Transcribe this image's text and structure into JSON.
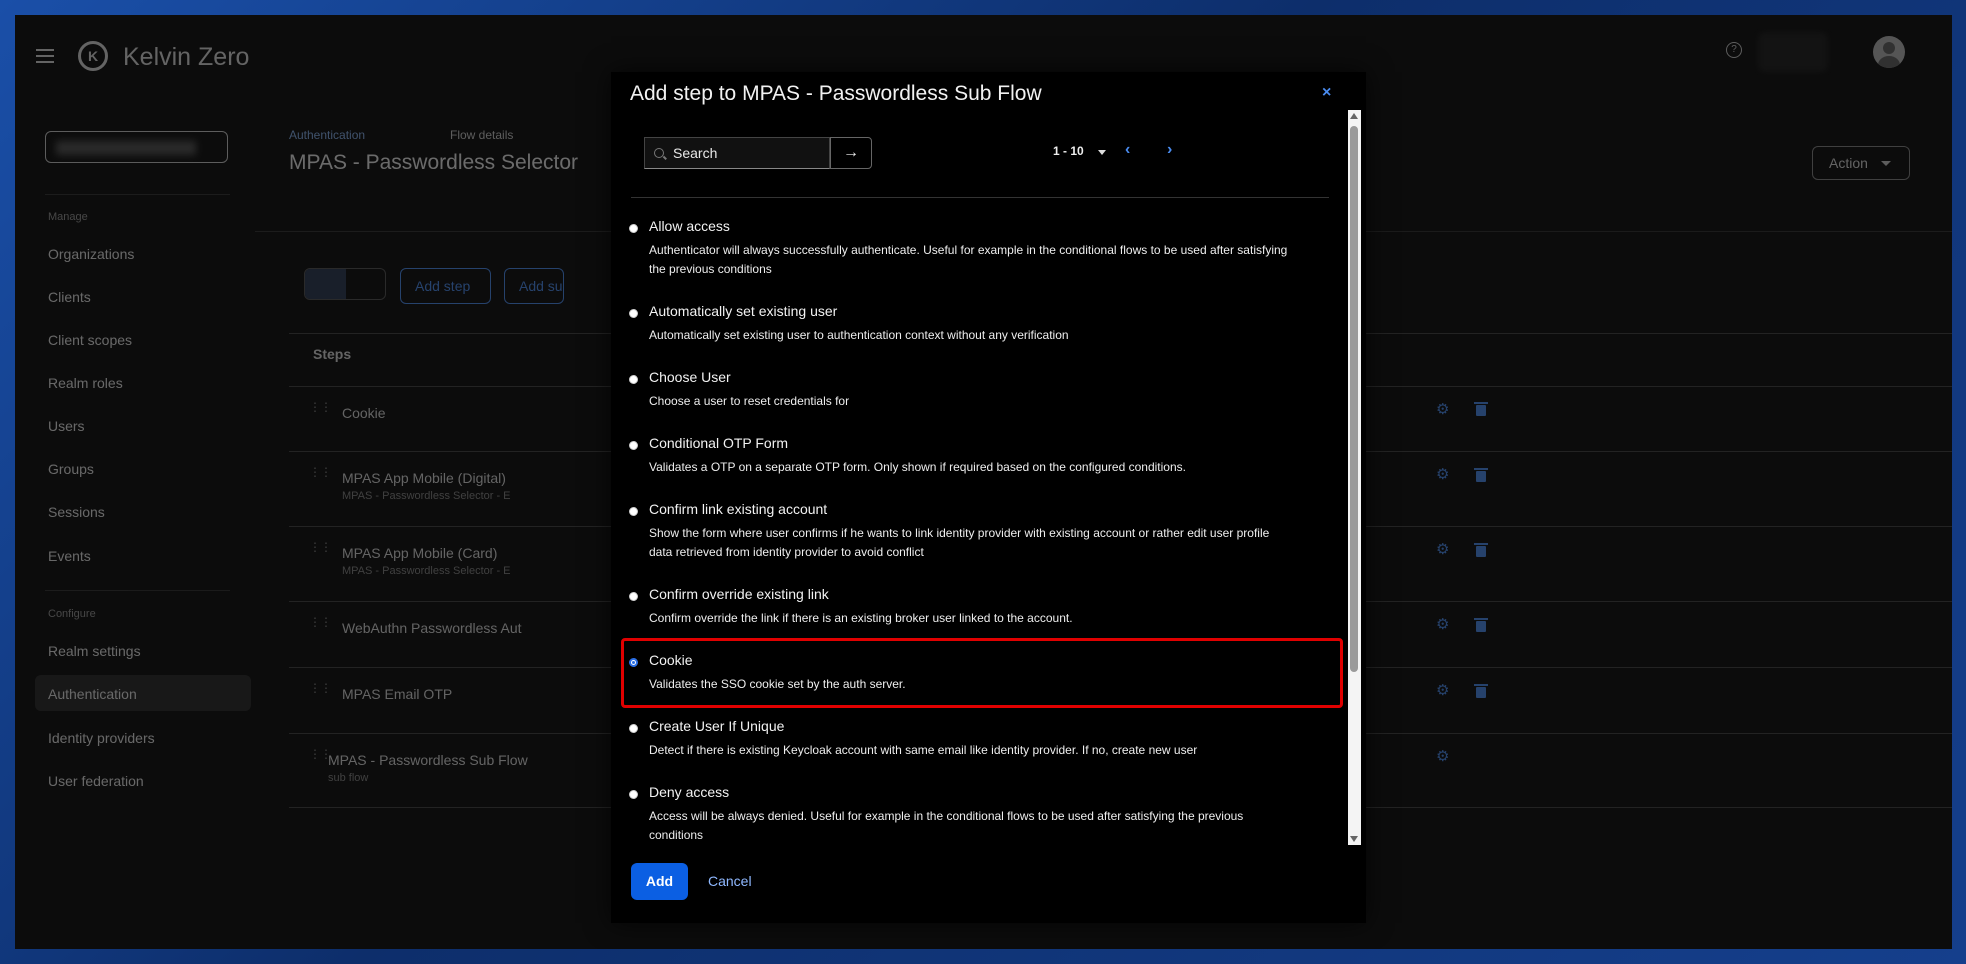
{
  "header": {
    "brand": "Kelvin Zero",
    "logo_letter": "K",
    "help_icon": "?"
  },
  "sidebar": {
    "section_manage": "Manage",
    "manage_items": [
      "Organizations",
      "Clients",
      "Client scopes",
      "Realm roles",
      "Users",
      "Groups",
      "Sessions",
      "Events"
    ],
    "section_configure": "Configure",
    "configure_items": [
      "Realm settings",
      "Authentication",
      "Identity providers",
      "User federation"
    ],
    "active_item": "Authentication"
  },
  "breadcrumb": {
    "items": [
      "Authentication",
      "Flow details"
    ]
  },
  "page": {
    "title": "MPAS - Passwordless Selector",
    "action_label": "Action",
    "add_step_label": "Add step",
    "add_sub_flow_label": "Add sub-flow",
    "steps_header": "Steps"
  },
  "steps": [
    {
      "title": "Cookie",
      "subtitle": ""
    },
    {
      "title": "MPAS App Mobile (Digital)",
      "subtitle": "MPAS - Passwordless Selector - E"
    },
    {
      "title": "MPAS App Mobile (Card)",
      "subtitle": "MPAS - Passwordless Selector - E"
    },
    {
      "title": "WebAuthn Passwordless Aut",
      "subtitle": ""
    },
    {
      "title": "MPAS Email OTP",
      "subtitle": ""
    },
    {
      "title": "MPAS - Passwordless Sub Flow",
      "subtitle": "sub flow"
    }
  ],
  "modal": {
    "title": "Add step to MPAS - Passwordless Sub Flow",
    "close_icon": "×",
    "search_placeholder": "Search",
    "search_go_icon": "→",
    "pager_range": "1 - 10",
    "pager_prev_icon": "‹",
    "pager_next_icon": "›",
    "options": [
      {
        "name": "Allow access",
        "desc": "Authenticator will always successfully authenticate. Useful for example in the conditional flows to be used after satisfying the previous conditions",
        "checked": false
      },
      {
        "name": "Automatically set existing user",
        "desc": "Automatically set existing user to authentication context without any verification",
        "checked": false
      },
      {
        "name": "Choose User",
        "desc": "Choose a user to reset credentials for",
        "checked": false
      },
      {
        "name": "Conditional OTP Form",
        "desc": "Validates a OTP on a separate OTP form. Only shown if required based on the configured conditions.",
        "checked": false
      },
      {
        "name": "Confirm link existing account",
        "desc": "Show the form where user confirms if he wants to link identity provider with existing account or rather edit user profile data retrieved from identity provider to avoid conflict",
        "checked": false
      },
      {
        "name": "Confirm override existing link",
        "desc": "Confirm override the link if there is an existing broker user linked to the account.",
        "checked": false
      },
      {
        "name": "Cookie",
        "desc": "Validates the SSO cookie set by the auth server.",
        "checked": true
      },
      {
        "name": "Create User If Unique",
        "desc": "Detect if there is existing Keycloak account with same email like identity provider. If no, create new user",
        "checked": false
      },
      {
        "name": "Deny access",
        "desc": "Access will be always denied. Useful for example in the conditional flows to be used after satisfying the previous conditions",
        "checked": false
      }
    ],
    "add_label": "Add",
    "cancel_label": "Cancel"
  },
  "colors": {
    "accent": "#0b5fe3",
    "link": "#4a8cf0",
    "highlight": "#e00000"
  }
}
